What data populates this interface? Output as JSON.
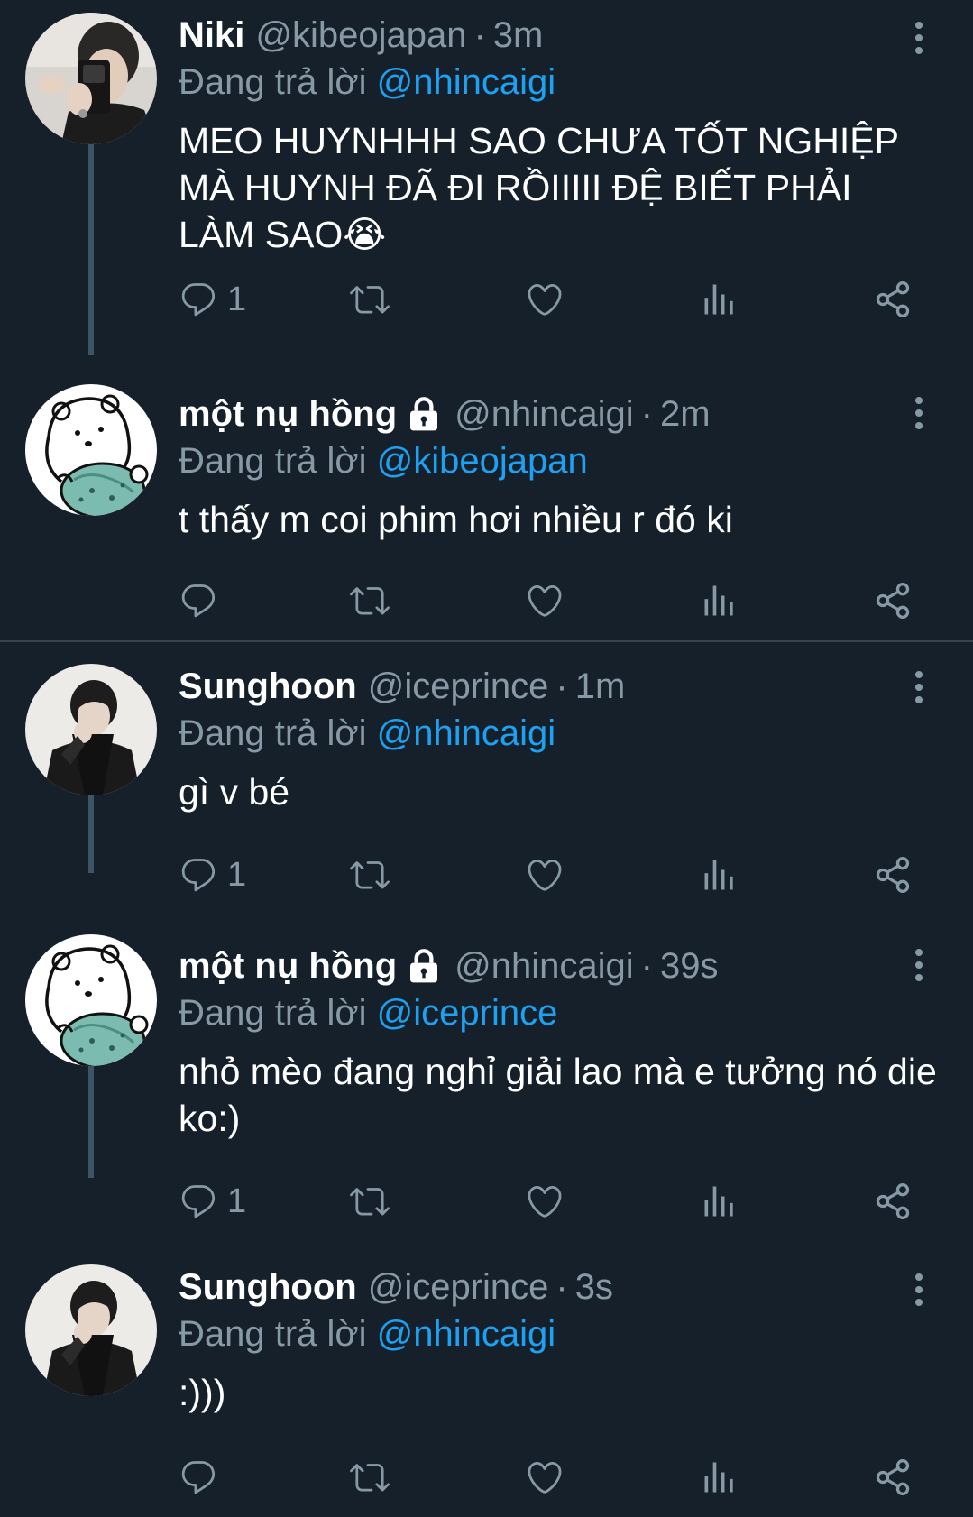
{
  "reply_prefix": "Đang trả lời",
  "tweets": [
    {
      "name": "Niki",
      "handle": "@kibeojapan",
      "time": "3m",
      "reply_to": "@nhincaigi",
      "text": "MEO HUYNHHH SAO CHƯA TỐT NGHIỆP MÀ HUYNH ĐÃ ĐI RỒIIIII ĐỆ BIẾT PHẢI LÀM SAO😭",
      "reply_count": "1",
      "locked": false,
      "avatar": "selfie-avatar"
    },
    {
      "name": "một nụ hồng",
      "handle": "@nhincaigi",
      "time": "2m",
      "reply_to": "@kibeojapan",
      "text": "t thấy m coi phim hơi nhiều r đó ki",
      "reply_count": "",
      "locked": true,
      "avatar": "bear-avatar"
    },
    {
      "name": "Sunghoon",
      "handle": "@iceprince",
      "time": "1m",
      "reply_to": "@nhincaigi",
      "text": "gì v bé",
      "reply_count": "1",
      "locked": false,
      "avatar": "person-avatar"
    },
    {
      "name": "một nụ hồng",
      "handle": "@nhincaigi",
      "time": "39s",
      "reply_to": "@iceprince",
      "text": "nhỏ mèo đang nghỉ giải lao mà e tưởng nó die ko:)",
      "reply_count": "1",
      "locked": true,
      "avatar": "bear-avatar"
    },
    {
      "name": "Sunghoon",
      "handle": "@iceprince",
      "time": "3s",
      "reply_to": "@nhincaigi",
      "text": ":)))",
      "reply_count": "",
      "locked": false,
      "avatar": "person-avatar"
    }
  ],
  "colors": {
    "background": "#15202b",
    "secondary_text": "#8899a6",
    "link": "#1da1f2",
    "thread_line": "#3d5466"
  }
}
